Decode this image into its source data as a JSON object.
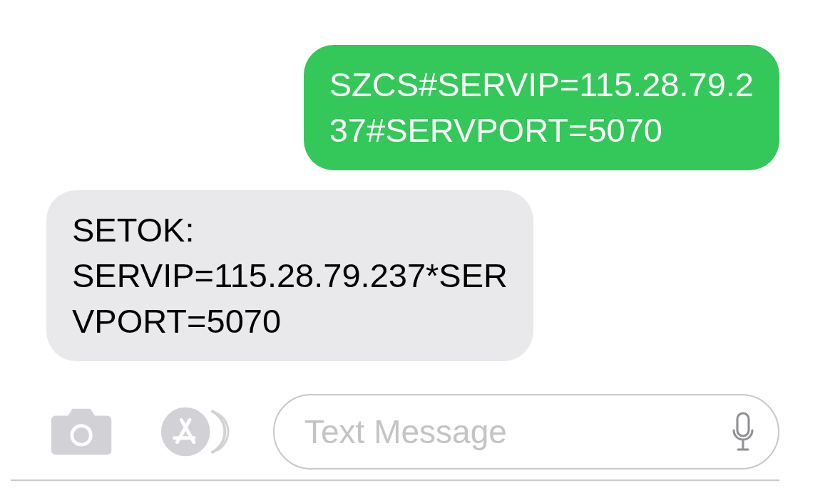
{
  "messages": [
    {
      "kind": "sent",
      "lines": [
        "SZCS#SERVIP=115.28.79.2",
        "37#SERVPORT=5070"
      ]
    },
    {
      "kind": "received",
      "lines": [
        "SETOK:",
        "SERVIP=115.28.79.237*SER",
        "VPORT=5070"
      ]
    }
  ],
  "composer": {
    "placeholder": "Text Message"
  }
}
